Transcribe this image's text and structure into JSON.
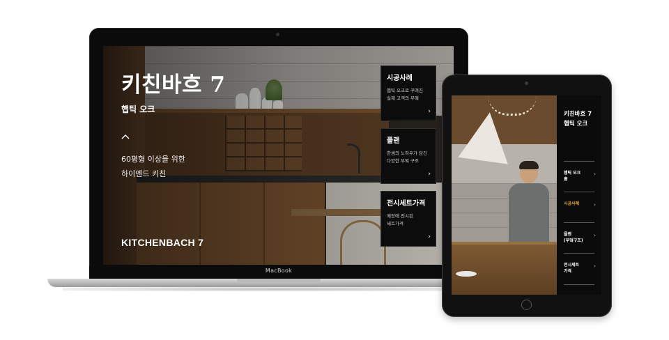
{
  "laptop": {
    "brand_label": "MacBook",
    "hero": {
      "title": "키친바흐 7",
      "subtitle": "햅틱 오크",
      "description_line1": "60평형 이상을 위한",
      "description_line2": "하이엔드 키친",
      "brand": "KITCHENBACH 7"
    },
    "cards": [
      {
        "title": "시공사례",
        "desc_line1": "햅틱 오크로 꾸며진",
        "desc_line2": "실제 고객의 부엌",
        "arrow": "›"
      },
      {
        "title": "플랜",
        "desc_line1": "한샘의 노하우가 담긴",
        "desc_line2": "다양한 부엌 구조",
        "arrow": "›"
      },
      {
        "title": "전시세트가격",
        "desc_line1": "매장에 전시된",
        "desc_line2": "세트가격",
        "arrow": "›"
      }
    ]
  },
  "tablet": {
    "panel_title_line1": "키친바흐 7",
    "panel_title_line2": "햅틱 오크",
    "menu": [
      {
        "line1": "햅틱 오크",
        "line2": "홈",
        "arrow": "›",
        "active": false
      },
      {
        "line1": "시공사례",
        "line2": "",
        "arrow": "›",
        "active": true
      },
      {
        "line1": "플랜",
        "line2": "(부엌구조)",
        "arrow": "›",
        "active": false
      },
      {
        "line1": "전시세트",
        "line2": "가격",
        "arrow": "›",
        "active": false
      }
    ],
    "active_color": "#e8a93a"
  }
}
